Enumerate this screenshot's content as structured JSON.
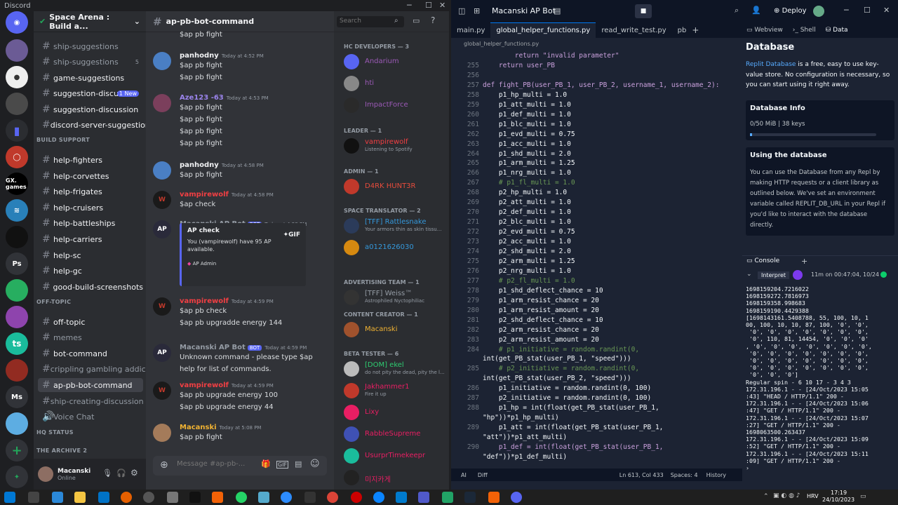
{
  "discord": {
    "app_title": "Discord",
    "server_name": "Space Arena : Build a...",
    "channel_name": "ap-pb-bot-command",
    "search_placeholder": "Search",
    "message_placeholder": "Message #ap-pb-...",
    "guild_labels": [
      "GX. games",
      "Ps",
      "ts",
      "Ms"
    ],
    "categories": {
      "build_support": "BUILD SUPPORT",
      "off_topic": "OFF-TOPIC",
      "hq_status": "HQ STATUS",
      "archive": "THE ARCHIVE 2"
    },
    "channels": [
      {
        "name": "ship-suggestions",
        "state": "muted"
      },
      {
        "name": "ship-suggestions",
        "state": "muted",
        "badge": "5"
      },
      {
        "name": "game-suggestions",
        "state": "unread"
      },
      {
        "name": "suggestion-discus...",
        "state": "unread",
        "badge": "1 New"
      },
      {
        "name": "suggestion-discussion",
        "state": "unread"
      },
      {
        "name": "discord-server-suggestion",
        "state": "unread"
      },
      {
        "name": "help-fighters",
        "state": "unread"
      },
      {
        "name": "help-corvettes",
        "state": "unread"
      },
      {
        "name": "help-frigates",
        "state": "unread"
      },
      {
        "name": "help-cruisers",
        "state": "unread"
      },
      {
        "name": "help-battleships",
        "state": "unread"
      },
      {
        "name": "help-carriers",
        "state": "unread"
      },
      {
        "name": "help-sc",
        "state": "unread"
      },
      {
        "name": "help-gc",
        "state": "unread"
      },
      {
        "name": "good-build-screenshots",
        "state": "unread"
      },
      {
        "name": "off-topic",
        "state": "unread"
      },
      {
        "name": "memes",
        "state": "muted"
      },
      {
        "name": "bot-command",
        "state": "unread"
      },
      {
        "name": "crippling gambling addic...",
        "state": "muted"
      },
      {
        "name": "ap-pb-bot-command",
        "state": "selected"
      },
      {
        "name": "ship-creating-discussion",
        "state": "muted"
      },
      {
        "name": "Voice Chat",
        "state": "muted"
      }
    ],
    "user": {
      "name": "Macanski",
      "status": "Online"
    },
    "messages": [
      {
        "author": "",
        "time": "",
        "lines": [
          "$ap pb fight"
        ],
        "color": "#f2f3f5"
      },
      {
        "author": "panhodny",
        "time": "Today at 4:52 PM",
        "lines": [
          "$ap pb fight",
          "$ap pb fight"
        ],
        "color": "#f2f3f5"
      },
      {
        "author": "Aze123 -63",
        "time": "Today at 4:53 PM",
        "lines": [
          "$ap pb fight",
          "$ap pb fight",
          "$ap pb fight",
          "$ap pb fight"
        ],
        "color": "#9b84ec"
      },
      {
        "author": "panhodny",
        "time": "Today at 4:58 PM",
        "lines": [
          "$ap pb fight"
        ],
        "color": "#f2f3f5"
      },
      {
        "author": "vampirewolf",
        "time": "Today at 4:58 PM",
        "lines": [
          "$ap check"
        ],
        "color": "#f23f43"
      },
      {
        "author": "Macanski AP Bot",
        "time": "Today at 4:58 PM",
        "bot": "BOT",
        "lines": [],
        "color": "#949ba4"
      },
      {
        "author": "vampirewolf",
        "time": "Today at 4:59 PM",
        "lines": [
          "$ap pb check",
          "$ap pb upgradde energy 144"
        ],
        "color": "#f23f43"
      },
      {
        "author": "Macanski AP Bot",
        "time": "Today at 4:59 PM",
        "bot": "BOT",
        "lines": [
          "Unknown command - please type $ap",
          "help for list of commands."
        ],
        "color": "#949ba4"
      },
      {
        "author": "vampirewolf",
        "time": "Today at 4:59 PM",
        "lines": [
          "$ap pb upgrade energy 100",
          "$ap pb upgrade energy 44"
        ],
        "color": "#f23f43"
      },
      {
        "author": "Macanski",
        "time": "Today at 5:08 PM",
        "lines": [
          "$ap pb fight"
        ],
        "color": "#f0b232"
      }
    ],
    "embed": {
      "title": "AP check",
      "body1": "You (vampirewolf) have 95 AP",
      "body2": "available.",
      "footer": "AP Admin",
      "gif": "GIF"
    },
    "member_groups": [
      {
        "title": "HC DEVELOPERS — 3",
        "members": [
          {
            "name": "Andarium",
            "color": "#9b59b6",
            "status": ""
          },
          {
            "name": "hti",
            "color": "#9b59b6",
            "status": ""
          },
          {
            "name": "ImpactForce",
            "color": "#9b59b6",
            "status": ""
          }
        ]
      },
      {
        "title": "LEADER — 1",
        "members": [
          {
            "name": "vampirewolf",
            "color": "#f23f43",
            "status": "Listening to Spotify"
          }
        ]
      },
      {
        "title": "ADMIN — 1",
        "members": [
          {
            "name": "D4RK HUNT3R",
            "color": "#e74c3c",
            "status": ""
          }
        ]
      },
      {
        "title": "SPACE TRANSLATOR — 2",
        "members": [
          {
            "name": "[TFF] Rattlesnake",
            "color": "#3498db",
            "status": "Your armors thin as skin tissu..."
          },
          {
            "name": "a0121626030",
            "color": "#3498db",
            "status": ""
          }
        ]
      },
      {
        "title": "ADVERTISING TEAM — 1",
        "members": [
          {
            "name": "[TFF] Weiss™",
            "color": "#949ba4",
            "status": "Astrophiled Nyctophiliac"
          }
        ]
      },
      {
        "title": "CONTENT CREATOR — 1",
        "members": [
          {
            "name": "Macanski",
            "color": "#f0b232",
            "status": ""
          }
        ]
      },
      {
        "title": "BETA TESTER — 6",
        "members": [
          {
            "name": "[DOM] ekel",
            "color": "#2ecc71",
            "status": "do not pity the dead, pity the l..."
          },
          {
            "name": "Jakhammer1",
            "color": "#e91e63",
            "status": "Fire it up"
          },
          {
            "name": "Lixy",
            "color": "#e91e63",
            "status": ""
          },
          {
            "name": "RabbleSupreme",
            "color": "#e91e63",
            "status": ""
          },
          {
            "name": "UsurprTimekeepr",
            "color": "#e91e63",
            "status": ""
          },
          {
            "name": "미지카게",
            "color": "#e91e63",
            "status": ""
          }
        ]
      }
    ]
  },
  "vscode": {
    "project": "Macanski AP Bot",
    "deploy": "Deploy",
    "tabs": [
      "main.py",
      "global_helper_functions.py",
      "read_write_test.py",
      "pb"
    ],
    "breadcrumb": "global_helper_functions.py",
    "code": [
      {
        "n": "",
        "t": "        return \"invalid parameter\""
      },
      {
        "n": "255",
        "t": "    return user_PB"
      },
      {
        "n": "256",
        "t": ""
      },
      {
        "n": "257",
        "t": "def fight_PB(user_PB_1, user_PB_2, username_1, username_2):"
      },
      {
        "n": "258",
        "t": "    p1_hp_multi = 1.0"
      },
      {
        "n": "259",
        "t": "    p1_att_multi = 1.0"
      },
      {
        "n": "260",
        "t": "    p1_def_multi = 1.0"
      },
      {
        "n": "261",
        "t": "    p1_blc_multi = 1.0"
      },
      {
        "n": "262",
        "t": "    p1_evd_multi = 0.75"
      },
      {
        "n": "263",
        "t": "    p1_acc_multi = 1.0"
      },
      {
        "n": "264",
        "t": "    p1_shd_multi = 2.0"
      },
      {
        "n": "265",
        "t": "    p1_arm_multi = 1.25"
      },
      {
        "n": "266",
        "t": "    p1_nrg_multi = 1.0"
      },
      {
        "n": "267",
        "t": "    # p1_fl_multi = 1.0"
      },
      {
        "n": "268",
        "t": "    p2_hp_multi = 1.0"
      },
      {
        "n": "269",
        "t": "    p2_att_multi = 1.0"
      },
      {
        "n": "270",
        "t": "    p2_def_multi = 1.0"
      },
      {
        "n": "271",
        "t": "    p2_blc_multi = 1.0"
      },
      {
        "n": "272",
        "t": "    p2_evd_multi = 0.75"
      },
      {
        "n": "273",
        "t": "    p2_acc_multi = 1.0"
      },
      {
        "n": "274",
        "t": "    p2_shd_multi = 2.0"
      },
      {
        "n": "275",
        "t": "    p2_arm_multi = 1.25"
      },
      {
        "n": "276",
        "t": "    p2_nrg_multi = 1.0"
      },
      {
        "n": "277",
        "t": "    # p2_fl_multi = 1.0"
      },
      {
        "n": "278",
        "t": "    p1_shd_deflect_chance = 10"
      },
      {
        "n": "279",
        "t": "    p1_arm_resist_chance = 20"
      },
      {
        "n": "280",
        "t": "    p1_arm_resist_amount = 20"
      },
      {
        "n": "281",
        "t": "    p2_shd_deflect_chance = 10"
      },
      {
        "n": "282",
        "t": "    p2_arm_resist_chance = 20"
      },
      {
        "n": "283",
        "t": "    p2_arm_resist_amount = 20"
      },
      {
        "n": "284",
        "t": "    # p1_initiative = random.randint(0,"
      },
      {
        "n": "",
        "t": "int(get_PB_stat(user_PB_1, \"speed\")))"
      },
      {
        "n": "285",
        "t": "    # p2_initiative = random.randint(0,"
      },
      {
        "n": "",
        "t": "int(get_PB_stat(user_PB_2, \"speed\")))"
      },
      {
        "n": "286",
        "t": "    p1_initiative = random.randint(0, 100)"
      },
      {
        "n": "287",
        "t": "    p2_initiative = random.randint(0, 100)"
      },
      {
        "n": "288",
        "t": "    p1_hp = int(float(get_PB_stat(user_PB_1,"
      },
      {
        "n": "",
        "t": "\"hp\"))*p1_hp_multi)"
      },
      {
        "n": "289",
        "t": "    p1_att = int(float(get_PB_stat(user_PB_1,"
      },
      {
        "n": "",
        "t": "\"att\"))*p1_att_multi)"
      },
      {
        "n": "290",
        "t": "    p1_def = int(float(get_PB_stat(user_PB_1,"
      },
      {
        "n": "",
        "t": "\"def\"))*p1_def_multi)"
      }
    ],
    "status": {
      "ai": "AI",
      "diff": "Diff",
      "pos": "Ln 613, Col 433",
      "spaces": "Spaces: 4",
      "history": "History"
    },
    "right_tabs": [
      "Webview",
      "Shell",
      "Data"
    ],
    "database": {
      "title": "Database",
      "link": "Replit Database",
      "desc": " is a free, easy to use key-value store. No configuration is necessary, so you can start using it right away.",
      "info_title": "Database Info",
      "info_usage": "0/50 MiB | 38 keys",
      "using_title": "Using the database",
      "using_text": "You can use the Database from any Repl by making HTTP requests or a client library as outlined below. We've set an environment variable called REPLIT_DB_URL in your Repl if you'd like to interact with the database directly."
    },
    "console": {
      "title": "Console",
      "mode": "Interpret",
      "runtime": "11m on 00:47:04, 10/24",
      "output": "1698159204.7216022\n1698159272.7816973\n1698159358.998683\n1698159190.4429388\n[1698143161.5408788, 55, 100, 10, 1\n00, 100, 10, 10, 87, 100, '0', '0',\n '0', '0', '0', '0', '0', '0', '0',\n '0', 110, 81, 14454, '0', '0', '0'\n, '0', '0', '0', '0', '0', '0', '0',\n '0', '0', '0', '0', '0', '0', '0',\n '0', '0', '0', '0', '0', '0', '0',\n '0', '0', '0', '0', '0', '0', '0',\n '0', '0', '0']\nRegular spin - 6 10 17 - 3 4 3\n172.31.196.1 - - [24/Oct/2023 15:05\n:43] \"HEAD / HTTP/1.1\" 200 -\n172.31.196.1 - - [24/Oct/2023 15:06\n:47] \"GET / HTTP/1.1\" 200 -\n172.31.196.1 - - [24/Oct/2023 15:07\n:27] \"GET / HTTP/1.1\" 200 -\n1698063500.263437\n172.31.196.1 - - [24/Oct/2023 15:09\n:52] \"GET / HTTP/1.1\" 200 -\n172.31.196.1 - - [24/Oct/2023 15:11\n:09] \"GET / HTTP/1.1\" 200 -\n›"
    }
  },
  "taskbar": {
    "lang": "HRV",
    "time": "17:19",
    "date": "24/10/2023"
  }
}
